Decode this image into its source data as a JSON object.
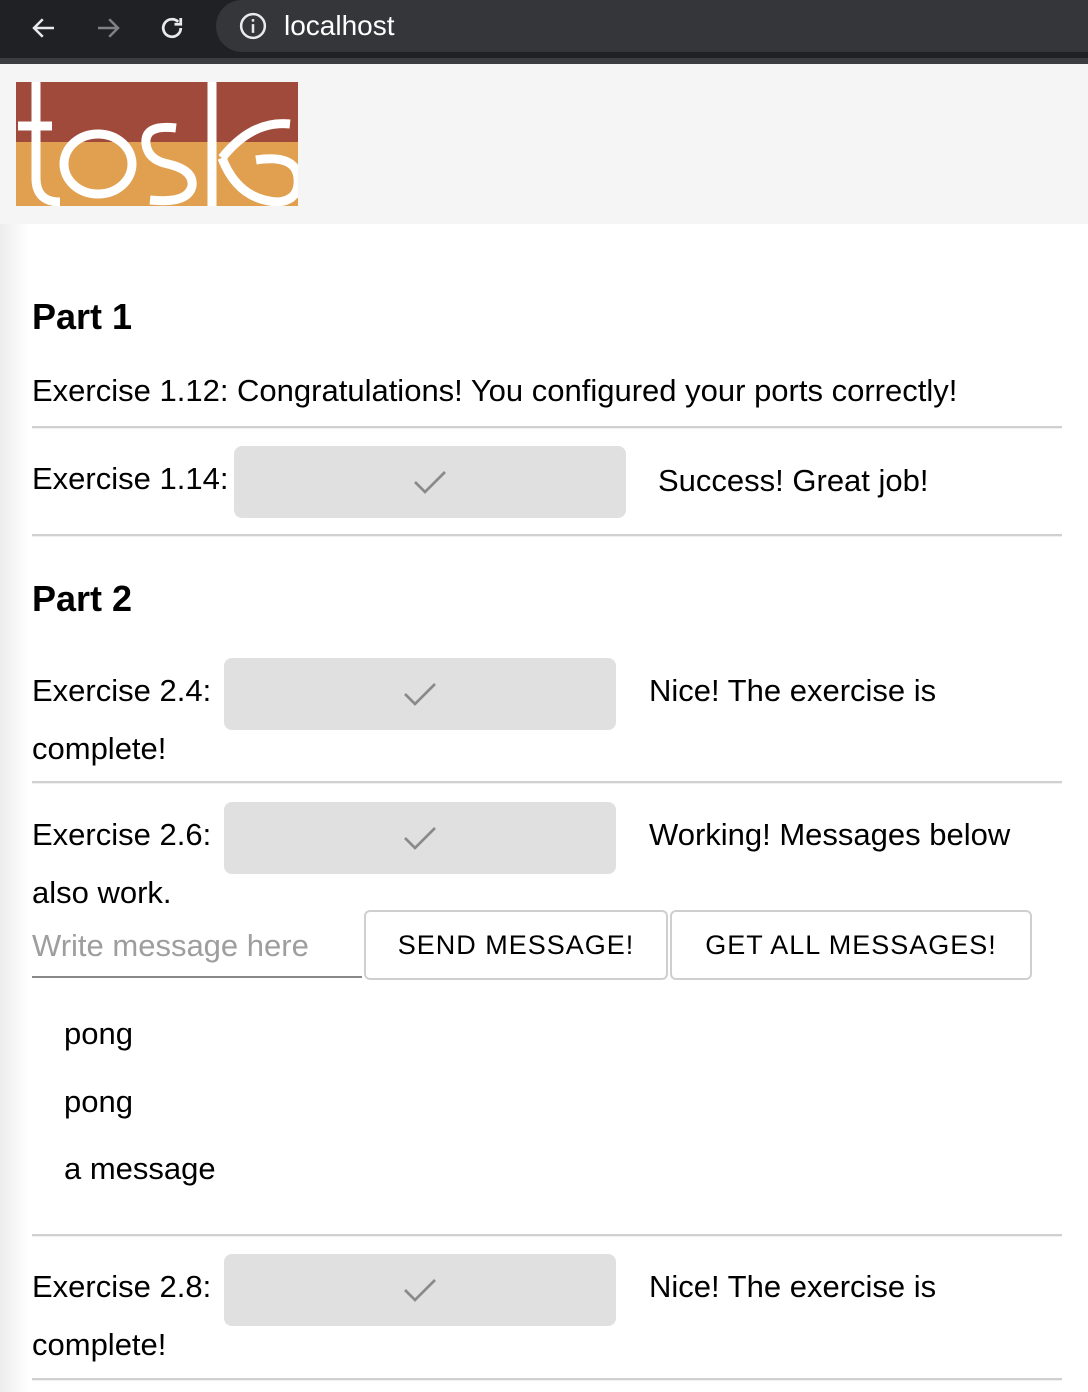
{
  "browser": {
    "url": "localhost"
  },
  "part1": {
    "title": "Part 1",
    "exercise_1_12": "Exercise 1.12: Congratulations! You configured your ports correctly!",
    "exercise_1_14": {
      "label": "Exercise 1.14:",
      "status": "Success! Great job!"
    }
  },
  "part2": {
    "title": "Part 2",
    "exercise_2_4": {
      "label": "Exercise 2.4:",
      "status_line1": "Nice! The exercise is",
      "status_line2": "complete!"
    },
    "exercise_2_6": {
      "label": "Exercise 2.6:",
      "status_line1": "Working! Messages below",
      "status_line2": "also work."
    },
    "message_input_placeholder": "Write message here",
    "send_button": "SEND MESSAGE!",
    "get_all_button": "GET ALL MESSAGES!",
    "messages": [
      "pong",
      "pong",
      "a message"
    ],
    "exercise_2_8": {
      "label": "Exercise 2.8:",
      "status_line1": "Nice! The exercise is",
      "status_line2": "complete!"
    }
  },
  "colors": {
    "logo_top": "#a04a3c",
    "logo_bottom": "#e0a050",
    "check_button_bg": "#e0e0e0",
    "check_mark": "#8a8a8a"
  }
}
